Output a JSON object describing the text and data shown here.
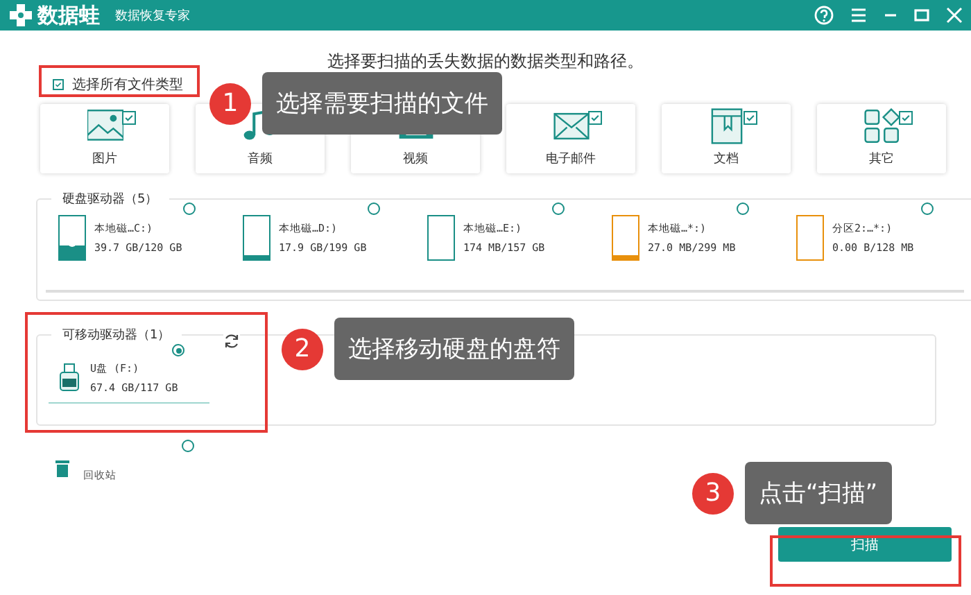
{
  "window": {
    "logo_text": "数据蛙",
    "subtitle": "数据恢复专家"
  },
  "instruction": "选择要扫描的丢失数据的数据类型和路径。",
  "select_all": {
    "label": "选择所有文件类型",
    "checked": true
  },
  "file_types": [
    {
      "label": "图片",
      "kind": "image",
      "checked": true
    },
    {
      "label": "音频",
      "kind": "audio"
    },
    {
      "label": "视频",
      "kind": "video"
    },
    {
      "label": "电子邮件",
      "kind": "email",
      "checked": true
    },
    {
      "label": "文档",
      "kind": "document",
      "checked": true
    },
    {
      "label": "其它",
      "kind": "other",
      "checked": true
    }
  ],
  "hard_drives": {
    "title": "硬盘驱动器（5）",
    "drives": [
      {
        "name": "本地磁…C:)",
        "usage": "39.7 GB/120 GB",
        "level": 0.3,
        "color": "#1a8f86",
        "kind": "system",
        "selected": false
      },
      {
        "name": "本地磁…D:)",
        "usage": "17.9 GB/199 GB",
        "level": 0.09,
        "color": "#1a8f86",
        "kind": "disk",
        "selected": false
      },
      {
        "name": "本地磁…E:)",
        "usage": "174 MB/157 GB",
        "level": 0,
        "color": "#1a8f86",
        "kind": "disk",
        "selected": false
      },
      {
        "name": "本地磁…*:)",
        "usage": "27.0 MB/299 MB",
        "level": 0.09,
        "color": "#e8900c",
        "kind": "disk",
        "selected": false
      },
      {
        "name": "分区2:…*:)",
        "usage": "0.00  B/128 MB",
        "level": 0,
        "color": "#e8900c",
        "kind": "disk",
        "selected": false
      }
    ]
  },
  "removable_drives": {
    "title": "可移动驱动器（1）",
    "drives": [
      {
        "name": "U盘 (F:)",
        "usage": "67.4 GB/117 GB",
        "selected": true
      }
    ]
  },
  "recycle_bin": {
    "label": "回收站",
    "selected": false
  },
  "callouts": [
    {
      "number": "1",
      "text": "选择需要扫描的文件"
    },
    {
      "number": "2",
      "text": "选择移动硬盘的盘符"
    },
    {
      "number": "3",
      "text": "点击“扫描”"
    }
  ],
  "scan_button": "扫描"
}
